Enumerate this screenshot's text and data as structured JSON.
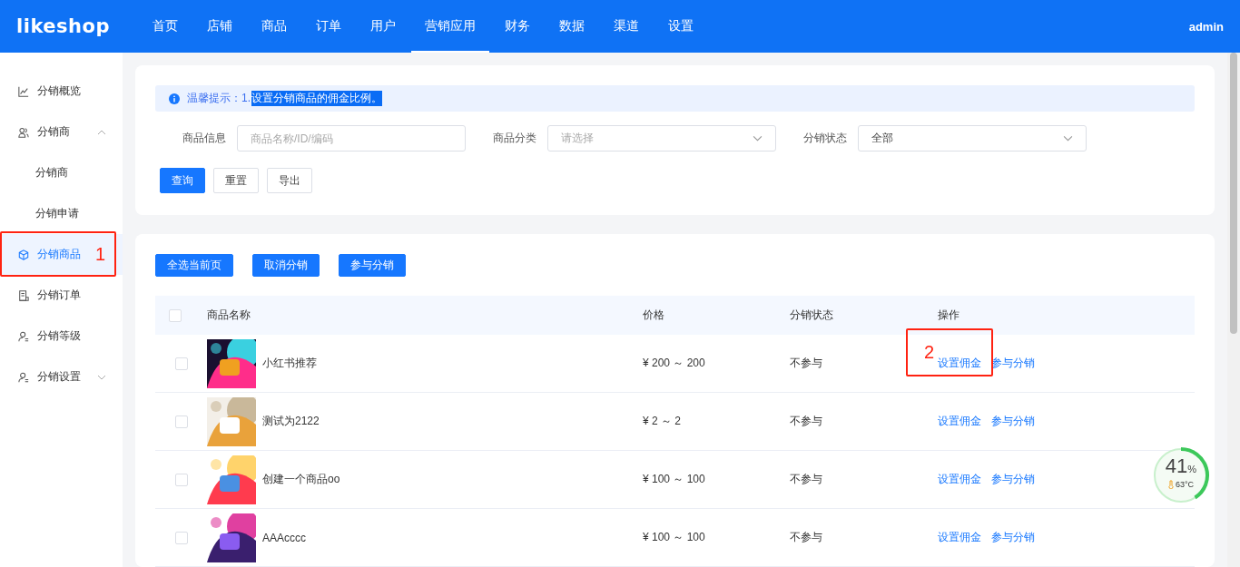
{
  "header": {
    "logo": "likeshop",
    "nav": [
      {
        "label": "首页",
        "selected": false
      },
      {
        "label": "店铺",
        "selected": false
      },
      {
        "label": "商品",
        "selected": false
      },
      {
        "label": "订单",
        "selected": false
      },
      {
        "label": "用户",
        "selected": false
      },
      {
        "label": "营销应用",
        "selected": true
      },
      {
        "label": "财务",
        "selected": false
      },
      {
        "label": "数据",
        "selected": false
      },
      {
        "label": "渠道",
        "selected": false
      },
      {
        "label": "设置",
        "selected": false
      }
    ],
    "user": "admin"
  },
  "sidebar": {
    "items": [
      {
        "kind": "item",
        "label": "分销概览",
        "selected": false
      },
      {
        "kind": "group",
        "label": "分销商",
        "selected": false,
        "expanded": true,
        "children": [
          {
            "label": "分销商",
            "selected": false
          },
          {
            "label": "分销申请",
            "selected": false
          }
        ]
      },
      {
        "kind": "item",
        "label": "分销商品",
        "selected": true,
        "annotation": "1"
      },
      {
        "kind": "item",
        "label": "分销订单",
        "selected": false
      },
      {
        "kind": "item",
        "label": "分销等级",
        "selected": false
      },
      {
        "kind": "group",
        "label": "分销设置",
        "selected": false,
        "expanded": false
      }
    ]
  },
  "filter": {
    "tip": {
      "text": "温馨提示：1.",
      "selected_text": "设置分销商品的佣金比例。"
    },
    "fields": [
      {
        "kind": "input",
        "label": "商品信息",
        "placeholder": "商品名称/ID/编码"
      },
      {
        "kind": "select",
        "label": "商品分类",
        "placeholder": "请选择"
      },
      {
        "kind": "select",
        "label": "分销状态",
        "value": "全部"
      }
    ],
    "buttons": [
      {
        "label": "查询",
        "primary": true
      },
      {
        "label": "重置",
        "primary": false
      },
      {
        "label": "导出",
        "primary": false
      }
    ]
  },
  "list": {
    "actions": [
      "全选当前页",
      "取消分销",
      "参与分销"
    ],
    "table": {
      "columns": [
        "商品名称",
        "价格",
        "分销状态",
        "操作"
      ],
      "header_checked": false,
      "rows": [
        {
          "checked": false,
          "name": "小红书推荐",
          "price": "¥ 200 ～ 200",
          "status": "不参与",
          "actions": [
            "设置佣金",
            "参与分销"
          ],
          "annotation": "2"
        },
        {
          "checked": false,
          "name": "测试为2122",
          "price": "¥ 2 ～ 2",
          "status": "不参与",
          "actions": [
            "设置佣金",
            "参与分销"
          ]
        },
        {
          "checked": false,
          "name": "创建一个商品oo",
          "price": "¥ 100 ～ 100",
          "status": "不参与",
          "actions": [
            "设置佣金",
            "参与分销"
          ]
        },
        {
          "checked": false,
          "name": "AAAcccc",
          "price": "¥ 100 ～ 100",
          "status": "不参与",
          "actions": [
            "设置佣金",
            "参与分销"
          ]
        }
      ]
    }
  },
  "gauge": {
    "value": "41",
    "unit": "%",
    "temperature": "63°C",
    "level": 0.41
  }
}
